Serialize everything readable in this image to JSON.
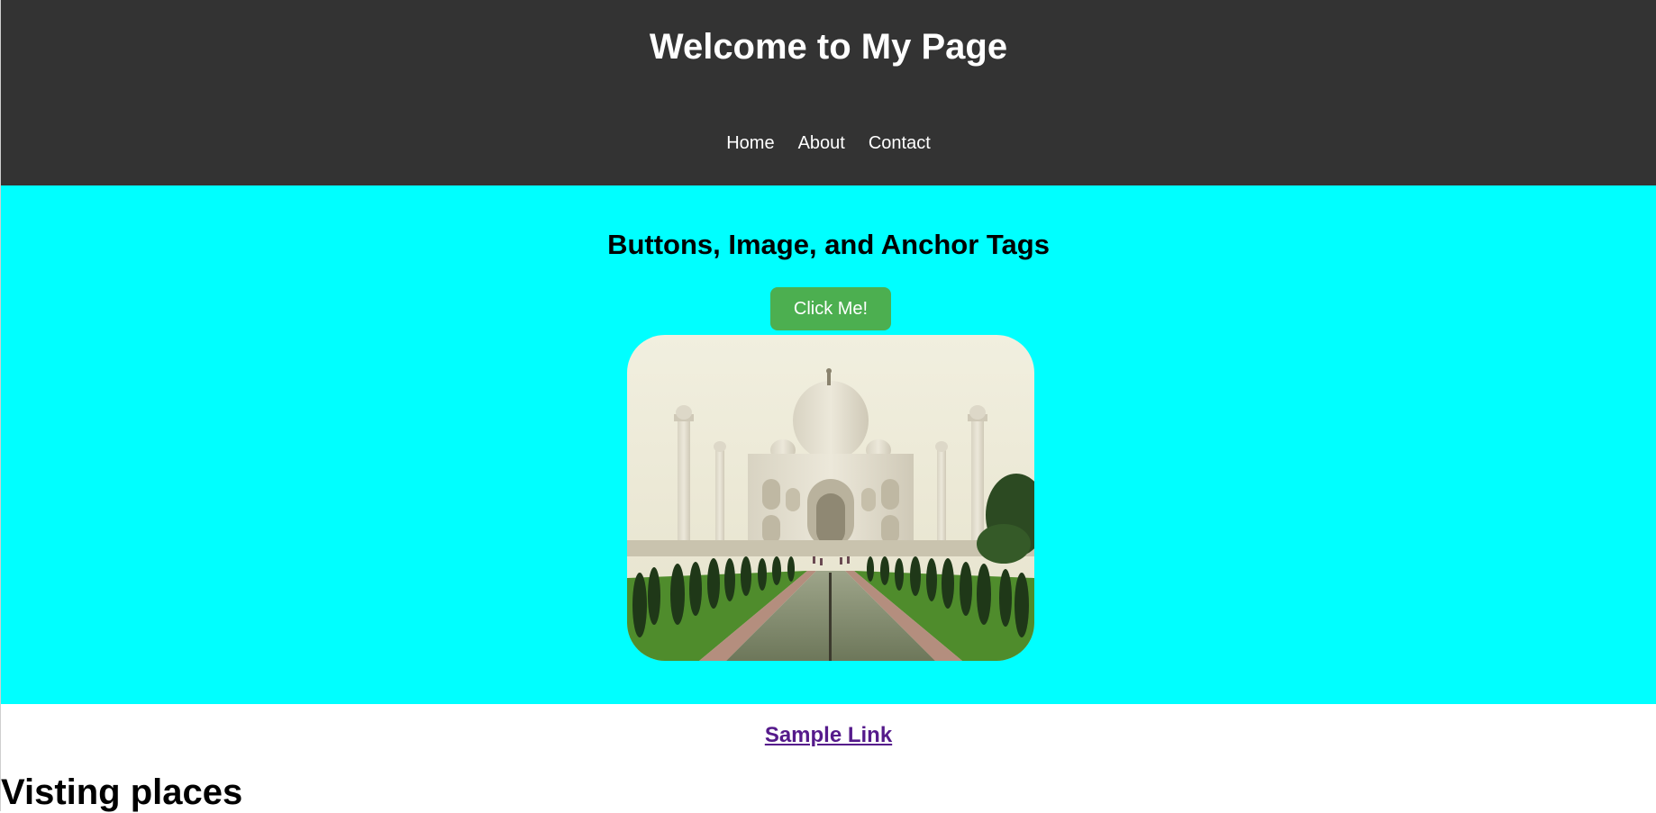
{
  "header": {
    "title": "Welcome to My Page",
    "nav": [
      {
        "label": "Home"
      },
      {
        "label": "About"
      },
      {
        "label": "Contact"
      }
    ]
  },
  "hero": {
    "heading": "Buttons, Image, and Anchor Tags",
    "button_label": "Click Me!",
    "image_subject": "taj-mahal-photo"
  },
  "link": {
    "label": "Sample Link"
  },
  "section": {
    "title": "Visting places"
  },
  "colors": {
    "header_bg": "#333333",
    "hero_bg": "#00ffff",
    "button_bg": "#4caf50",
    "link": "#551a8b"
  }
}
